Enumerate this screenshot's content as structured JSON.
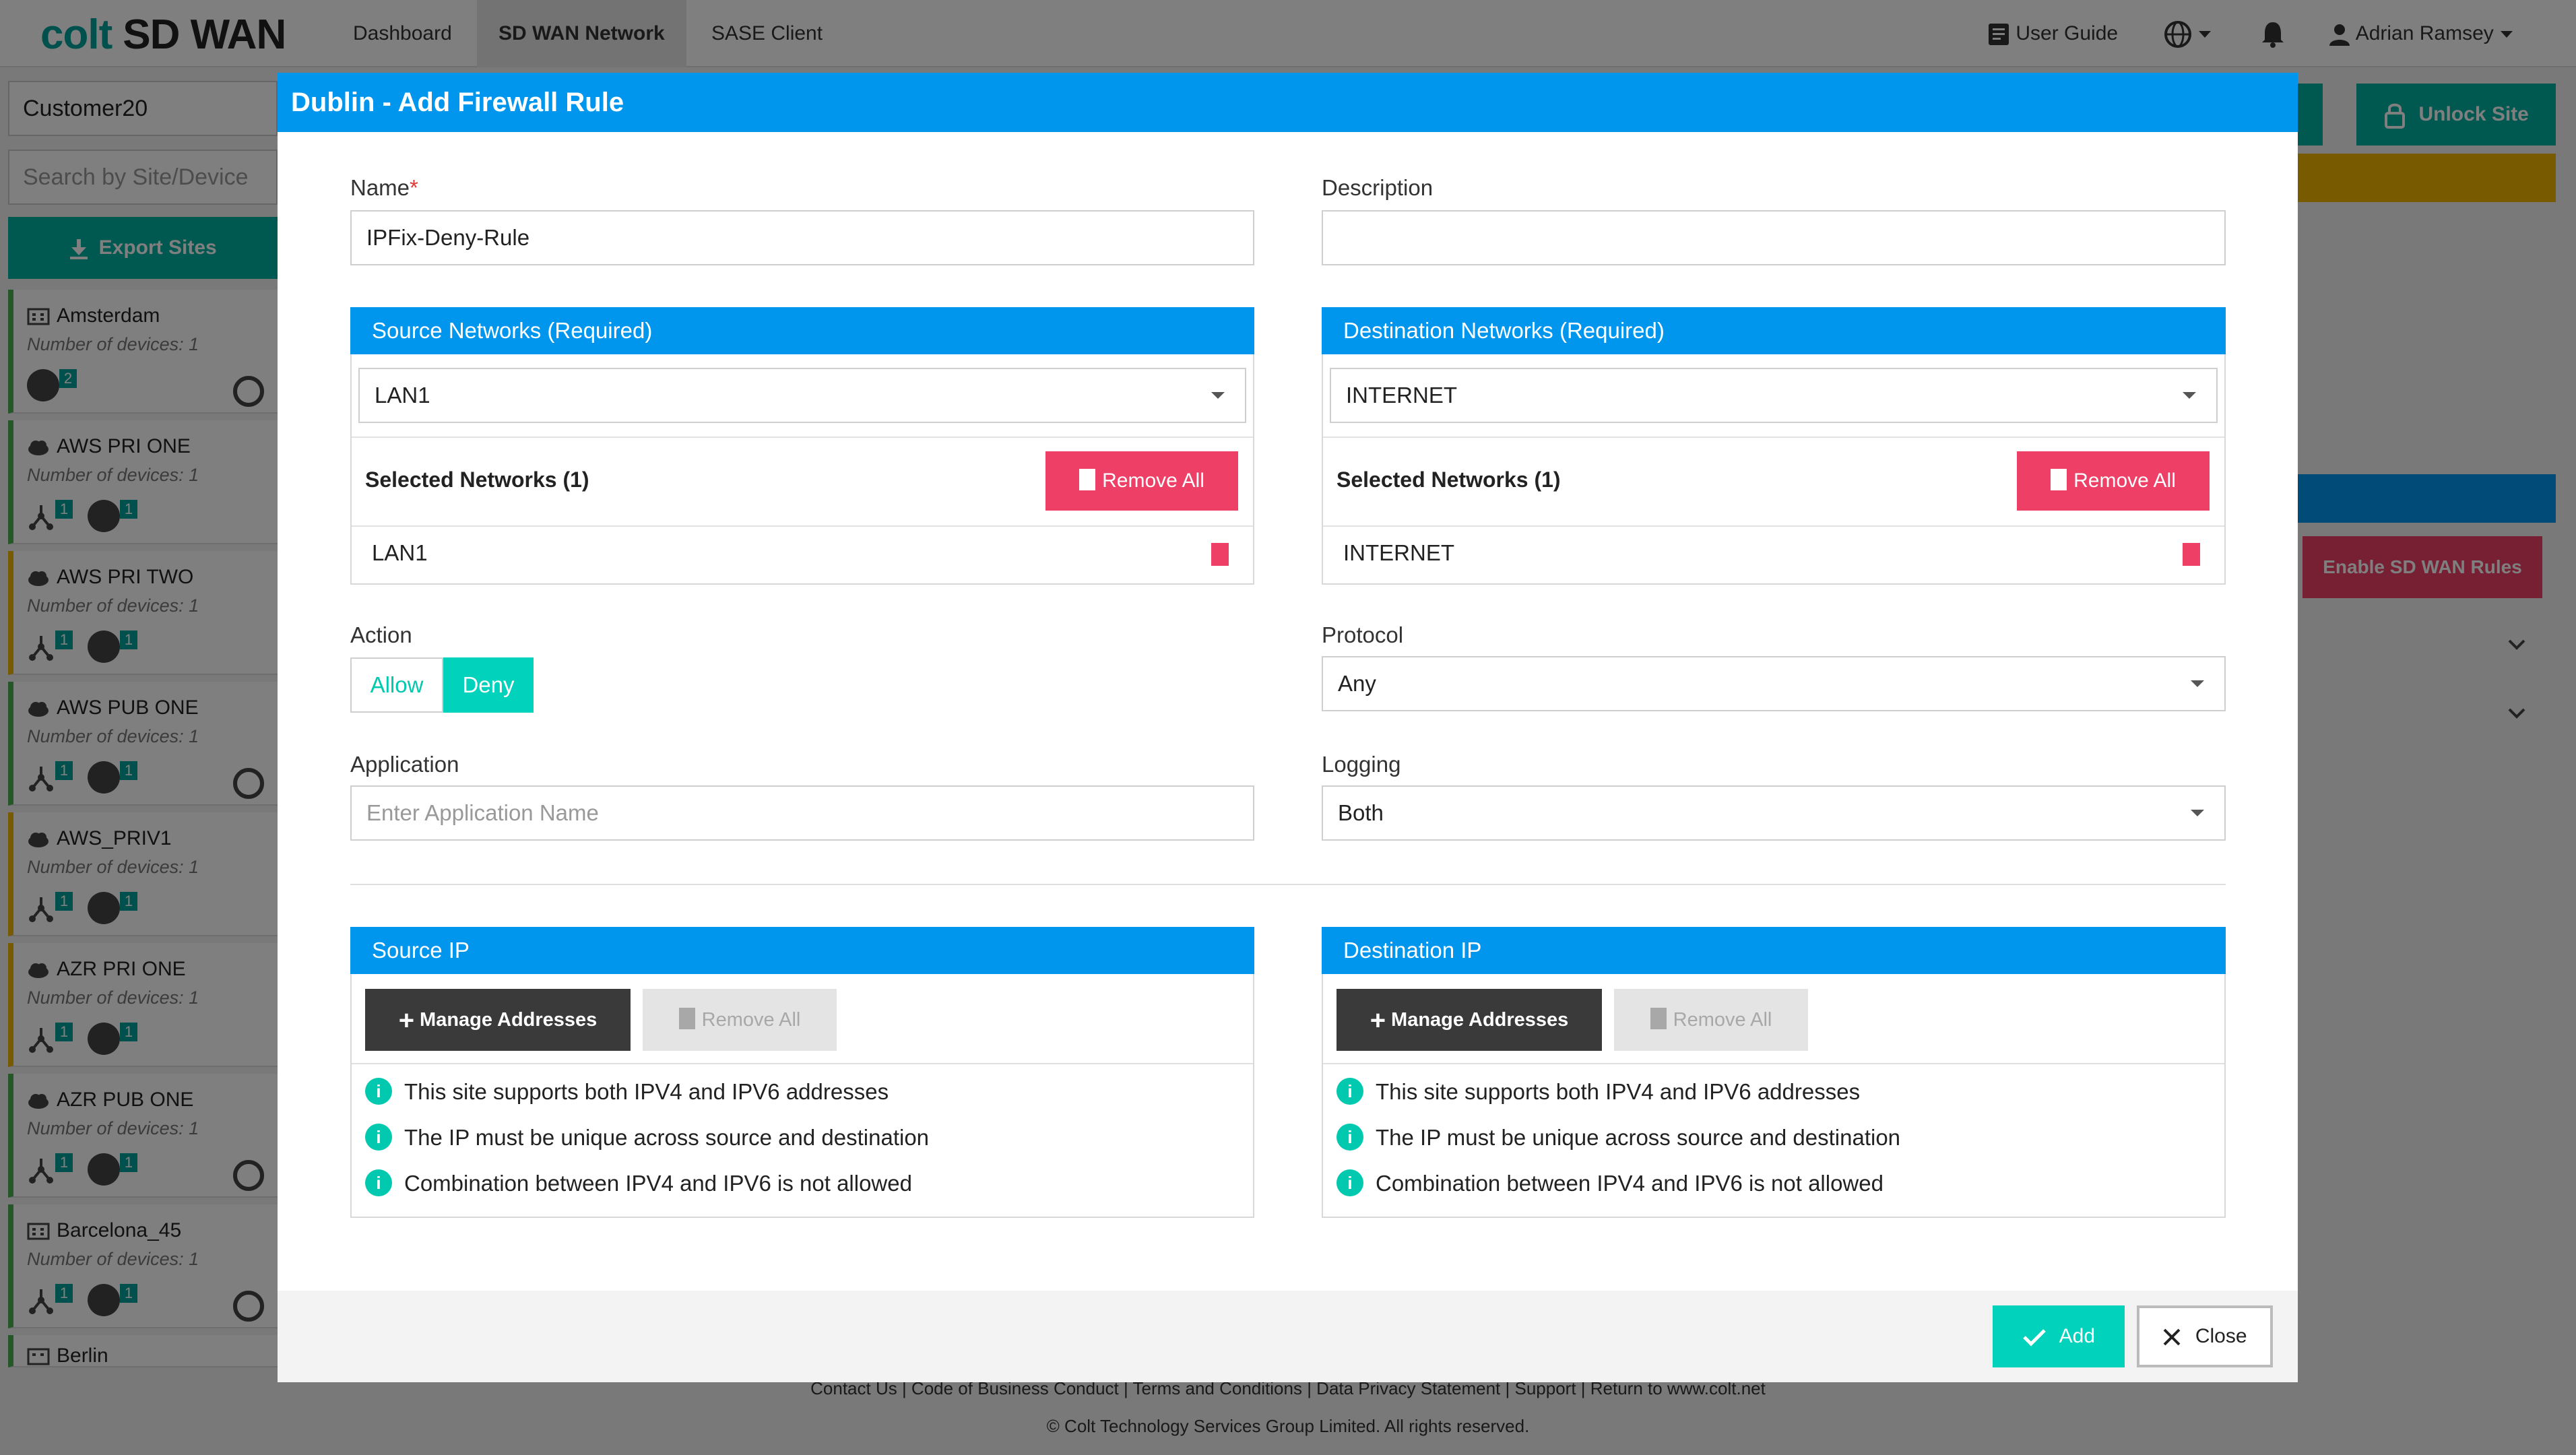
{
  "app": {
    "logo_brand": "colt",
    "logo_product": "SD WAN",
    "nav": [
      "Dashboard",
      "SD WAN Network",
      "SASE Client"
    ],
    "user_guide": "User Guide",
    "user_name": "Adrian Ramsey"
  },
  "sidebar": {
    "customer": "Customer20",
    "search_placeholder": "Search by Site/Device",
    "export_label": "Export Sites",
    "sites": [
      {
        "name": "Amsterdam",
        "devices": "Number of devices: 1",
        "badge": "2"
      },
      {
        "name": "AWS PRI ONE",
        "devices": "Number of devices: 1",
        "badge1": "1",
        "badge2": "1"
      },
      {
        "name": "AWS PRI TWO",
        "devices": "Number of devices: 1",
        "badge1": "1",
        "badge2": "1"
      },
      {
        "name": "AWS PUB ONE",
        "devices": "Number of devices: 1",
        "badge1": "1",
        "badge2": "1"
      },
      {
        "name": "AWS_PRIV1",
        "devices": "Number of devices: 1",
        "badge1": "1",
        "badge2": "1"
      },
      {
        "name": "AZR PRI ONE",
        "devices": "Number of devices: 1",
        "badge1": "1",
        "badge2": "1"
      },
      {
        "name": "AZR PUB ONE",
        "devices": "Number of devices: 1",
        "badge1": "1",
        "badge2": "1"
      },
      {
        "name": "Barcelona_45",
        "devices": "Number of devices: 1",
        "badge1": "1",
        "badge2": "1"
      },
      {
        "name": "Berlin"
      }
    ]
  },
  "background": {
    "unlock_label": "Unlock Site",
    "enable_rules_label": "Enable SD WAN Rules"
  },
  "footer": {
    "links": "Contact Us | Code of Business Conduct | Terms and Conditions | Data Privacy Statement | Support | Return to www.colt.net",
    "copyright": "© Colt Technology Services Group Limited. All rights reserved."
  },
  "modal": {
    "title": "Dublin - Add Firewall Rule",
    "name_label": "Name",
    "name_value": "IPFix-Deny-Rule",
    "description_label": "Description",
    "description_value": "",
    "source_networks": {
      "header": "Source Networks (Required)",
      "selected": "LAN1",
      "selected_title": "Selected Networks (1)",
      "remove_all": "Remove All",
      "items": [
        "LAN1"
      ]
    },
    "destination_networks": {
      "header": "Destination Networks (Required)",
      "selected": "INTERNET",
      "selected_title": "Selected Networks (1)",
      "remove_all": "Remove All",
      "items": [
        "INTERNET"
      ]
    },
    "action_label": "Action",
    "action_allow": "Allow",
    "action_deny": "Deny",
    "action_selected": "Deny",
    "protocol_label": "Protocol",
    "protocol_value": "Any",
    "application_label": "Application",
    "application_placeholder": "Enter Application Name",
    "logging_label": "Logging",
    "logging_value": "Both",
    "source_ip": {
      "header": "Source IP",
      "manage": "Manage Addresses",
      "remove_all": "Remove All",
      "info": [
        "This site supports both IPV4 and IPV6 addresses",
        "The IP must be unique across source and destination",
        "Combination between IPV4 and IPV6 is not allowed"
      ]
    },
    "destination_ip": {
      "header": "Destination IP",
      "manage": "Manage Addresses",
      "remove_all": "Remove All",
      "info": [
        "This site supports both IPV4 and IPV6 addresses",
        "The IP must be unique across source and destination",
        "Combination between IPV4 and IPV6 is not allowed"
      ]
    },
    "add_label": "Add",
    "close_label": "Close"
  },
  "colors": {
    "primary_blue": "#0096ee",
    "teal": "#00d2bb",
    "danger": "#ee3f66",
    "dark_button": "#3a3a3a"
  }
}
